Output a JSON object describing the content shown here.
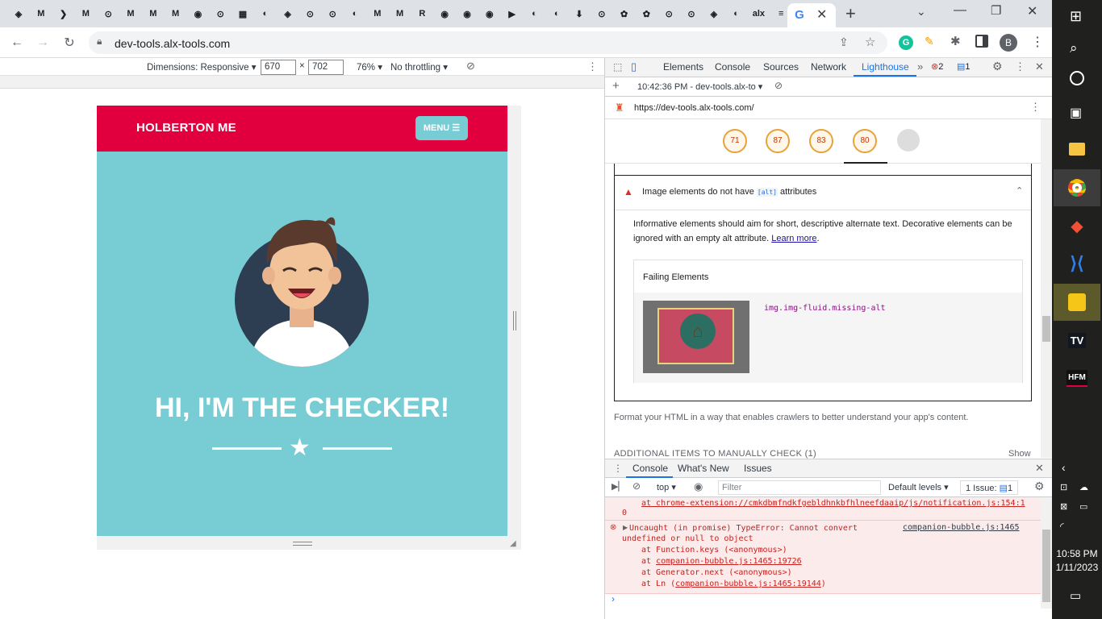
{
  "browser": {
    "url": "dev-tools.alx-tools.com",
    "tab_icons": [
      "◈",
      "M",
      "❯",
      "M",
      "⊙",
      "M",
      "M",
      "M",
      "◉",
      "⊙",
      "▦",
      "◐",
      "◈",
      "⊙",
      "⊙",
      "◐",
      "M",
      "M",
      "R",
      "◉",
      "◉",
      "◉",
      "▶",
      "◐",
      "◐",
      "⬇",
      "⊙",
      "✿",
      "✿",
      "⊙",
      "⊙",
      "◈",
      "◐",
      "alx",
      "≡",
      "G"
    ]
  },
  "device_toolbar": {
    "dimensions_label": "Dimensions: Responsive",
    "width": "670",
    "height": "702",
    "zoom": "76%",
    "throttling": "No throttling"
  },
  "site": {
    "brand": "HOLBERTON ME",
    "menu_label": "MENU",
    "hero_title": "HI, I'M THE CHECKER!"
  },
  "devtools": {
    "tabs": [
      "Elements",
      "Console",
      "Sources",
      "Network",
      "Lighthouse"
    ],
    "active_tab": "Lighthouse",
    "error_count": "2",
    "issue_count": "1",
    "report_time": "10:42:36 PM - dev-tools.alx-to",
    "report_url": "https://dev-tools.alx-tools.com/",
    "scores": [
      "71",
      "87",
      "83",
      "80"
    ],
    "audit_title_pre": "Image elements do not have",
    "audit_code": "[alt]",
    "audit_title_post": "attributes",
    "audit_desc": "Informative elements should aim for short, descriptive alternate text. Decorative elements can be ignored with an empty alt attribute.",
    "learn_more": "Learn more",
    "failing_label": "Failing Elements",
    "failing_selector": "img.img-fluid.missing-alt",
    "format_text": "Format your HTML in a way that enables crawlers to better understand your app's content.",
    "manual_check": "ADDITIONAL ITEMS TO MANUALLY CHECK (1)",
    "show_label": "Show"
  },
  "drawer": {
    "tabs": [
      "Console",
      "What's New",
      "Issues"
    ],
    "context": "top",
    "filter_placeholder": "Filter",
    "levels": "Default levels",
    "issues_label": "1 Issue:",
    "issues_count": "1",
    "log_line1": "at chrome-extension://cmkdbmfndkfgebldhnkbfhlneefdaaip/js/notification.js:154:1",
    "log_line1b": "0",
    "error_line1": "Uncaught (in promise) TypeError: Cannot convert",
    "error_source": "companion-bubble.js:1465",
    "error_line2": "undefined or null to object",
    "stack1": "at Function.keys (<anonymous>)",
    "stack2_pre": "at ",
    "stack2_link": "companion-bubble.js:1465:19726",
    "stack3": "at Generator.next (<anonymous>)",
    "stack4_pre": "at Ln (",
    "stack4_link": "companion-bubble.js:1465:19144",
    "stack4_post": ")"
  },
  "taskbar": {
    "time": "10:58 PM",
    "date": "1/11/2023"
  },
  "colors": {
    "brand_red": "#e1003d",
    "teal": "#77cdd3",
    "score_orange": "#e8a23a",
    "error_red": "#d93025",
    "link_blue": "#1a0dab"
  }
}
